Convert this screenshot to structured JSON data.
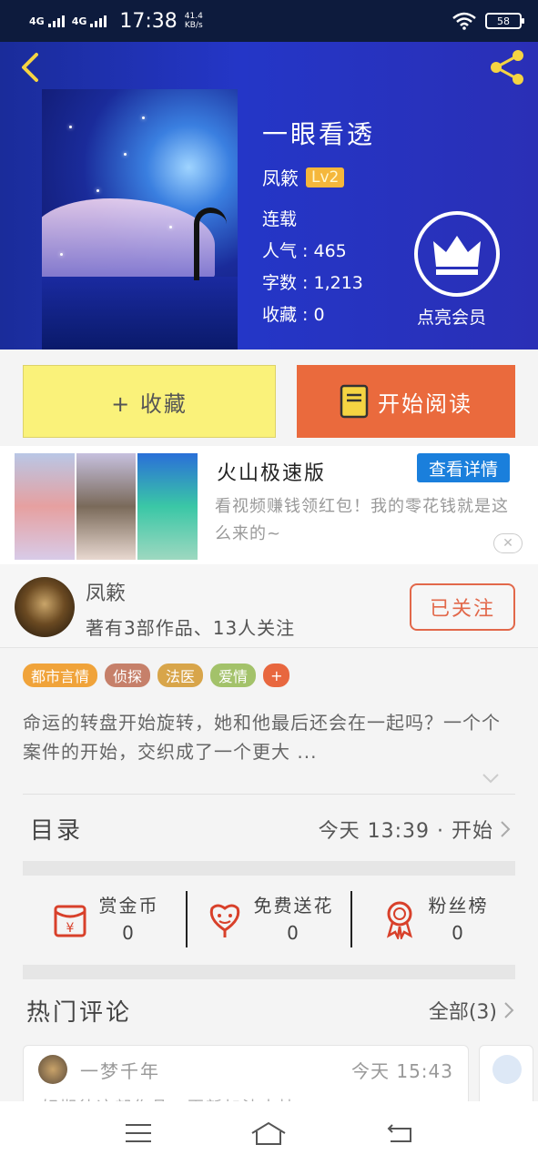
{
  "status_bar": {
    "network1": "4G",
    "network2": "4G",
    "time": "17:38",
    "speed_value": "41.4",
    "speed_unit": "KB/s",
    "battery": "58"
  },
  "book": {
    "title": "一眼看透",
    "author": "凤簌",
    "level": "Lv2",
    "status": "连载",
    "popularity_label": "人气",
    "popularity_value": "465",
    "words_label": "字数",
    "words_value": "1,213",
    "favorites_label": "收藏",
    "favorites_value": "0",
    "vip_label": "点亮会员"
  },
  "buttons": {
    "favorite": "+ 收藏",
    "read": "开始阅读"
  },
  "ad": {
    "title": "火山极速版",
    "details_button": "查看详情",
    "description": "看视频赚钱领红包！我的零花钱就是这么来的~",
    "close_symbol": "✕"
  },
  "author_card": {
    "name": "凤簌",
    "subtitle": "著有3部作品、13人关注",
    "follow_button": "已关注"
  },
  "tags": [
    {
      "label": "都市言情",
      "color": "#f0a33a"
    },
    {
      "label": "侦探",
      "color": "#c6806a"
    },
    {
      "label": "法医",
      "color": "#d8a54a"
    },
    {
      "label": "爱情",
      "color": "#a3c26a"
    },
    {
      "label": "+",
      "color": "#e8673f"
    }
  ],
  "description": "命运的转盘开始旋转，她和他最后还会在一起吗？一个个案件的开始，交织成了一个更大 ...",
  "toc": {
    "label": "目录",
    "latest": "今天 13:39 · 开始"
  },
  "actions": [
    {
      "label": "赏金币",
      "value": "0",
      "icon": "red-envelope-icon"
    },
    {
      "label": "免费送花",
      "value": "0",
      "icon": "flower-icon"
    },
    {
      "label": "粉丝榜",
      "value": "0",
      "icon": "medal-icon"
    }
  ],
  "comments": {
    "title": "热门评论",
    "all_label": "全部(3)",
    "first": {
      "user": "一梦千年",
      "time": "今天 15:43",
      "text": "好期待这部作品，更新加油支持"
    }
  },
  "colors": {
    "header_blue": "#2436c7",
    "read_button": "#ea6a3d",
    "favorite_button": "#faf27a",
    "level_badge": "#f5b73b",
    "ad_button": "#1a7fdc",
    "follow_accent": "#e2684a"
  }
}
